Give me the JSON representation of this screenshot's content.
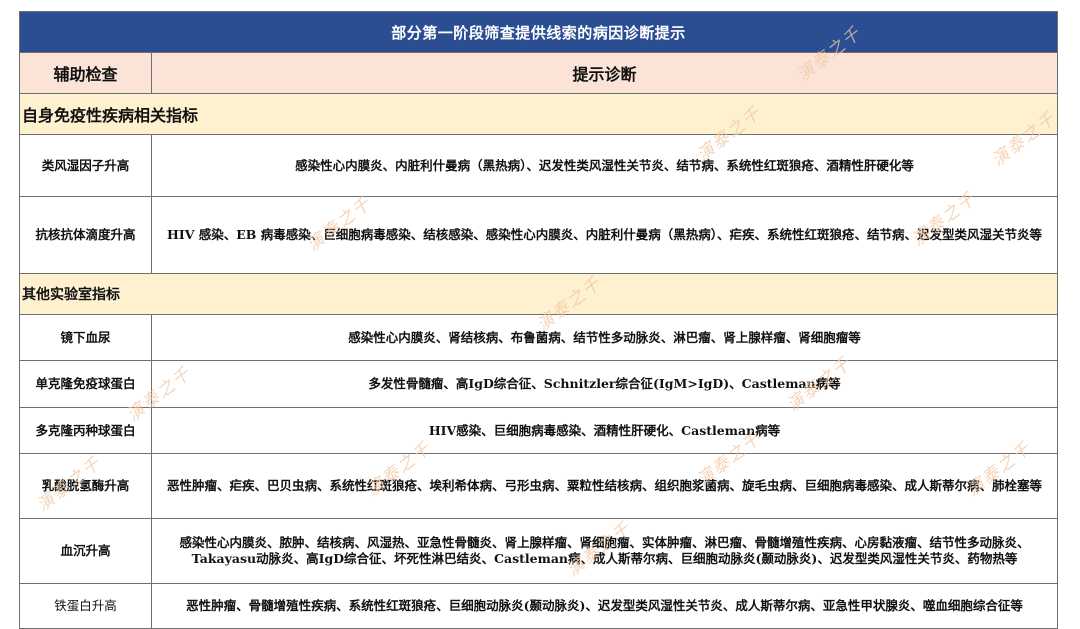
{
  "table": {
    "title": "部分第一阶段筛查提供线索的病因诊断提示",
    "headers": [
      "辅助检查",
      "提示诊断"
    ],
    "sections": [
      {
        "label": "自身免疫性疾病相关指标",
        "rows": [
          {
            "test": "类风湿因子升高",
            "diagnosis": "感染性心内膜炎、内脏利什曼病（黑热病）、迟发性类风湿性关节炎、结节病、系统性红斑狼疮、酒精性肝硬化等"
          },
          {
            "test": "抗核抗体滴度升高",
            "diagnosis": "HIV 感染、EB 病毒感染、巨细胞病毒感染、结核感染、感染性心内膜炎、内脏利什曼病（黑热病）、疟疾、系统性红斑狼疮、结节病、迟发型类风湿关节炎等"
          }
        ]
      },
      {
        "label": "其他实验室指标",
        "rows": [
          {
            "test": "镜下血尿",
            "diagnosis": "感染性心内膜炎、肾结核病、布鲁菌病、结节性多动脉炎、淋巴瘤、肾上腺样瘤、肾细胞瘤等"
          },
          {
            "test": "单克隆免疫球蛋白",
            "diagnosis": "多发性骨髓瘤、高IgD综合征、Schnitzler综合征(IgM>IgD)、Castleman病等"
          },
          {
            "test": "多克隆丙种球蛋白",
            "diagnosis": "HIV感染、巨细胞病毒感染、酒精性肝硬化、Castleman病等"
          },
          {
            "test": "乳酸脱氢酶升高",
            "diagnosis": "恶性肿瘤、疟疾、巴贝虫病、系统性红斑狼疮、埃利希体病、弓形虫病、粟粒性结核病、组织胞浆菌病、旋毛虫病、巨细胞病毒感染、成人斯蒂尔病、肺栓塞等"
          },
          {
            "test": "血沉升高",
            "diagnosis": "感染性心内膜炎、脓肿、结核病、风湿热、亚急性骨髓炎、肾上腺样瘤、肾细胞瘤、实体肿瘤、淋巴瘤、骨髓增殖性疾病、心房黏液瘤、结节性多动脉炎、Takayasu动脉炎、高IgD综合征、坏死性淋巴结炎、Castleman病、成人斯蒂尔病、巨细胞动脉炎(颞动脉炎)、迟发型类风湿性关节炎、药物热等"
          },
          {
            "test": "铁蛋白升高",
            "diagnosis": "恶性肿瘤、骨髓增殖性疾病、系统性红斑狼疮、巨细胞动脉炎(颞动脉炎)、迟发型类风湿性关节炎、成人斯蒂尔病、亚急性甲状腺炎、噬血细胞综合征等"
          }
        ]
      }
    ]
  },
  "watermark": {
    "text": "演泰之千",
    "color": "#f2c6a2"
  }
}
